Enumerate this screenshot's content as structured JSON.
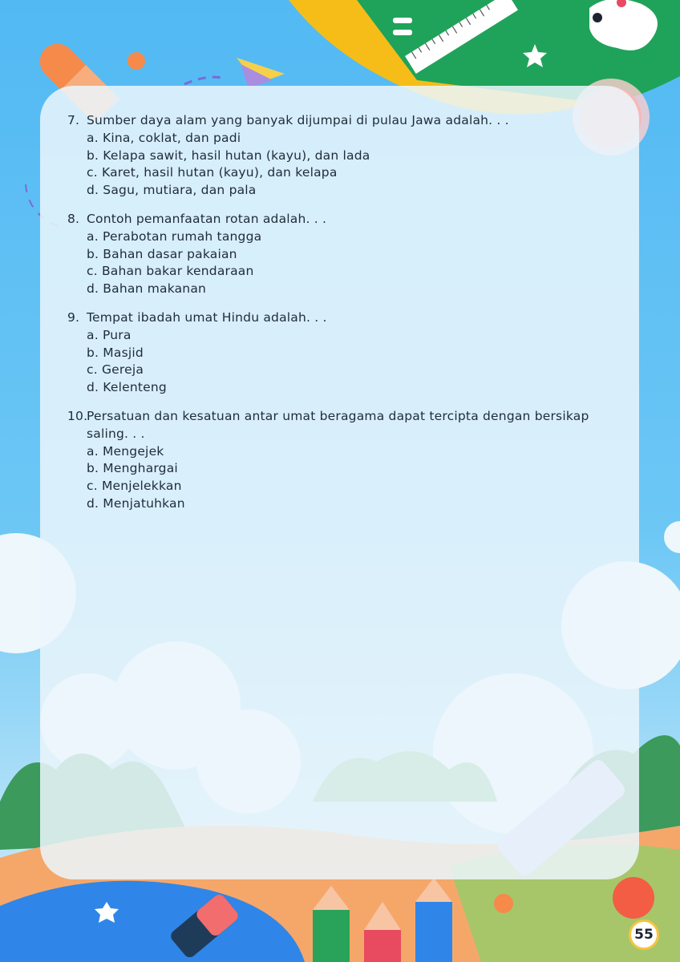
{
  "questions": [
    {
      "number": "7.",
      "text": "Sumber daya alam yang banyak dijumpai di pulau Jawa adalah. . .",
      "options": [
        "a. Kina, coklat, dan padi",
        "b. Kelapa sawit, hasil hutan (kayu), dan lada",
        "c. Karet, hasil hutan (kayu), dan kelapa",
        "d. Sagu, mutiara, dan pala"
      ]
    },
    {
      "number": "8.",
      "text": "Contoh pemanfaatan rotan adalah. . .",
      "options": [
        "a. Perabotan rumah tangga",
        "b. Bahan dasar pakaian",
        "c. Bahan bakar kendaraan",
        "d. Bahan makanan"
      ]
    },
    {
      "number": "9.",
      "text": "Tempat ibadah umat Hindu adalah. . .",
      "options": [
        "a. Pura",
        "b. Masjid",
        "c. Gereja",
        "d. Kelenteng"
      ]
    },
    {
      "number": "10.",
      "text": "Persatuan dan kesatuan antar umat beragama dapat tercipta dengan bersikap saling. . .",
      "options": [
        "a. Mengejek",
        "b. Menghargai",
        "c. Menjelekkan",
        "d. Menjatuhkan"
      ]
    }
  ],
  "page_number": "55",
  "colors": {
    "sky": "#52b9f3",
    "green_board": "#1fa35a",
    "yellow_band": "#f6bd18",
    "orange_ground": "#f5a76a",
    "lake": "#2f86e8"
  }
}
